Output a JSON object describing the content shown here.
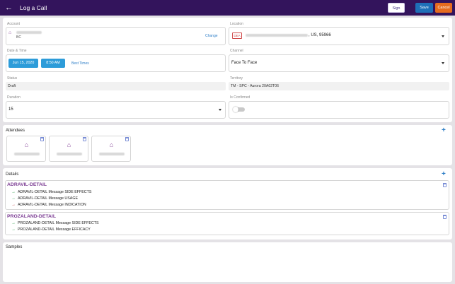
{
  "header": {
    "back_icon": "arrow-left-icon",
    "title": "Log a Call",
    "sign_label": "Sign",
    "save_label": "Save",
    "cancel_label": "Cancel"
  },
  "form": {
    "account": {
      "label": "Account",
      "sub": "BC",
      "change_label": "Change"
    },
    "location": {
      "label": "Location",
      "badge": "DEA",
      "value_suffix": ", US, 95966"
    },
    "datetime": {
      "label": "Date & Time",
      "date": "Jun 15, 2020",
      "time": "8:50 AM",
      "best_times": "Best Times"
    },
    "channel": {
      "label": "Channel",
      "value": "Face To Face"
    },
    "status": {
      "label": "Status",
      "value": "Draft"
    },
    "territory": {
      "label": "Territory",
      "value": "TM - SPC - Aurora 20A02T06"
    },
    "duration": {
      "label": "Duration",
      "value": "15"
    },
    "is_confirmed": {
      "label": "Is Confirmed",
      "checked": false
    }
  },
  "attendees": {
    "title": "Attendees",
    "count": 3
  },
  "details": {
    "title": "Details",
    "groups": [
      {
        "name": "ADRAVIL-DETAIL",
        "messages": [
          {
            "text": "ADRAVIL-DETAIL Message SIDE EFFECTS",
            "arrow": "green"
          },
          {
            "text": "ADRAVIL-DETAIL Message USAGE",
            "arrow": "green"
          },
          {
            "text": "ADRAVIL-DETAIL Message INDICATION",
            "arrow": "red"
          }
        ]
      },
      {
        "name": "PROZALAND-DETAIL",
        "messages": [
          {
            "text": "PROZALAND-DETAIL Message SIDE EFFECTS",
            "arrow": "green"
          },
          {
            "text": "PROZALAND-DETAIL Message EFFICACY",
            "arrow": "green"
          }
        ]
      }
    ]
  },
  "samples": {
    "title": "Samples"
  },
  "colors": {
    "header_bg": "#33145c",
    "save": "#1e6fb8",
    "cancel": "#e66b1e",
    "accent": "#7b3c93",
    "link": "#2d7ec7"
  }
}
